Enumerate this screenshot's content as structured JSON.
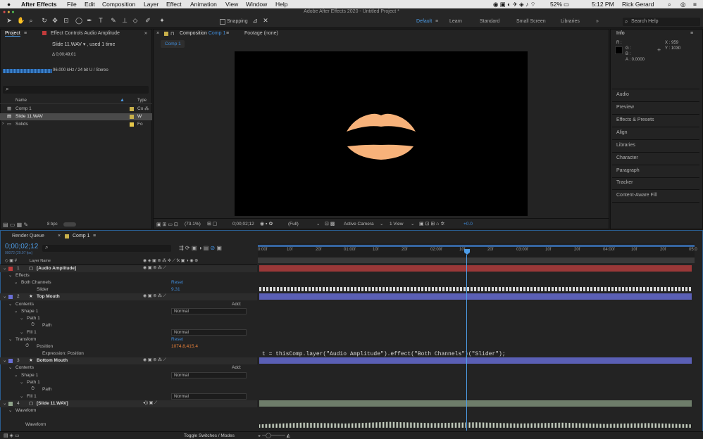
{
  "menubar": {
    "apple": "",
    "app": "After Effects",
    "items": [
      "File",
      "Edit",
      "Composition",
      "Layer",
      "Effect",
      "Animation",
      "View",
      "Window",
      "Help"
    ],
    "battery": "52%",
    "time": "5:12 PM",
    "user": "Rick Gerard"
  },
  "window_title": "Adobe After Effects 2020 - Untitled Project *",
  "toolbar": {
    "snapping": "Snapping",
    "workspaces": [
      "Default",
      "Learn",
      "Standard",
      "Small Screen",
      "Libraries"
    ],
    "search_help": "Search Help"
  },
  "project_panel": {
    "tab_project": "Project",
    "tab_effect_controls": "Effect Controls Audio Amplitude",
    "footage_name": "Slide 11.WAV ▾ , used 1 time",
    "duration": "Δ 0;00;49;01",
    "audio_info": "96.000 kHz / 24 bit U / Stereo",
    "col_name": "Name",
    "col_type": "Type",
    "items": [
      {
        "name": "Comp 1",
        "type": "Co",
        "color": "#c8b04a"
      },
      {
        "name": "Slide 11.WAV",
        "type": "W",
        "color": "#c8b04a"
      },
      {
        "name": "Solids",
        "type": "Fo",
        "color": "#e6c84a"
      }
    ],
    "bpc": "8 bpc"
  },
  "comp_panel": {
    "tab_comp_prefix": "Composition",
    "tab_comp_name": "Comp 1",
    "tab_footage": "Footage (none)",
    "subtab": "Comp 1",
    "zoom": "(73.1%)",
    "timecode": "0;00;02;12",
    "quality": "(Full)",
    "camera": "Active Camera",
    "views": "1 View",
    "exposure": "+0.0",
    "lip_color": "#f7b27a"
  },
  "info_panel": {
    "title": "Info",
    "r": "R :",
    "g": "G :",
    "b": "B :",
    "a": "A :  0.0000",
    "x": "X : 959",
    "y": "Y : 1030",
    "sections": [
      "Audio",
      "Preview",
      "Effects & Presets",
      "Align",
      "Libraries",
      "Character",
      "Paragraph",
      "Tracker",
      "Content-Aware Fill"
    ]
  },
  "timeline": {
    "tab_render": "Render Queue",
    "tab_comp": "Comp 1",
    "timecode": "0;00;02;12",
    "frames": "00072 (29.97 fps)",
    "col_layer_name": "Layer Name",
    "toggle": "Toggle Switches / Modes",
    "ruler": [
      "0:00f",
      "10f",
      "20f",
      "01:00f",
      "10f",
      "20f",
      "02:00f",
      "10f",
      "20f",
      "03:00f",
      "10f",
      "20f",
      "04:00f",
      "10f",
      "20f",
      "05:0"
    ],
    "expression": "t = thisComp.layer(\"Audio Amplitude\").effect(\"Both Channels\")(\"Slider\");",
    "rows": [
      {
        "num": "1",
        "name": "[Audio Amplitude]",
        "indent": 0,
        "kind": "layer",
        "color": "#c23b3b",
        "bar": "#9a3838"
      },
      {
        "num": "",
        "name": "Effects",
        "indent": 1,
        "kind": "group"
      },
      {
        "num": "",
        "name": "Both Channels",
        "indent": 2,
        "kind": "group",
        "value": "Reset",
        "value_kind": "blue"
      },
      {
        "num": "",
        "name": "Slider",
        "indent": 4,
        "kind": "prop",
        "value": "9.31",
        "value_kind": "blue"
      },
      {
        "num": "2",
        "name": "Top Mouth",
        "indent": 0,
        "kind": "layer",
        "color": "#6a6fd6",
        "bar": "#5a5fb5"
      },
      {
        "num": "",
        "name": "Contents",
        "indent": 1,
        "kind": "group",
        "value": "Add:",
        "value_kind": "plain"
      },
      {
        "num": "",
        "name": "Shape 1",
        "indent": 2,
        "kind": "group",
        "value": "Normal",
        "value_kind": "select"
      },
      {
        "num": "",
        "name": "Path 1",
        "indent": 3,
        "kind": "group"
      },
      {
        "num": "",
        "name": "Path",
        "indent": 5,
        "kind": "prop"
      },
      {
        "num": "",
        "name": "Fill 1",
        "indent": 3,
        "kind": "group",
        "value": "Normal",
        "value_kind": "select"
      },
      {
        "num": "",
        "name": "Transform",
        "indent": 1,
        "kind": "group",
        "value": "Reset",
        "value_kind": "blue"
      },
      {
        "num": "",
        "name": "Position",
        "indent": 4,
        "kind": "prop",
        "value": "1074.8,415.4",
        "value_kind": "orange"
      },
      {
        "num": "",
        "name": "Expression: Position",
        "indent": 5,
        "kind": "prop"
      },
      {
        "num": "3",
        "name": "Bottom Mouth",
        "indent": 0,
        "kind": "layer",
        "color": "#6a6fd6",
        "bar": "#5a5fb5"
      },
      {
        "num": "",
        "name": "Contents",
        "indent": 1,
        "kind": "group",
        "value": "Add:",
        "value_kind": "plain"
      },
      {
        "num": "",
        "name": "Shape 1",
        "indent": 2,
        "kind": "group",
        "value": "Normal",
        "value_kind": "select"
      },
      {
        "num": "",
        "name": "Path 1",
        "indent": 3,
        "kind": "group"
      },
      {
        "num": "",
        "name": "Path",
        "indent": 5,
        "kind": "prop"
      },
      {
        "num": "",
        "name": "Fill 1",
        "indent": 3,
        "kind": "group",
        "value": "Normal",
        "value_kind": "select"
      },
      {
        "num": "4",
        "name": "[Slide 11.WAV]",
        "indent": 0,
        "kind": "layer",
        "color": "#8fa38a",
        "bar": "#6e7d6a"
      },
      {
        "num": "",
        "name": "Waveform",
        "indent": 1,
        "kind": "group"
      },
      {
        "num": "",
        "name": "",
        "indent": 0,
        "kind": "blank"
      },
      {
        "num": "",
        "name": "Waveform",
        "indent": 2,
        "kind": "prop"
      }
    ]
  }
}
